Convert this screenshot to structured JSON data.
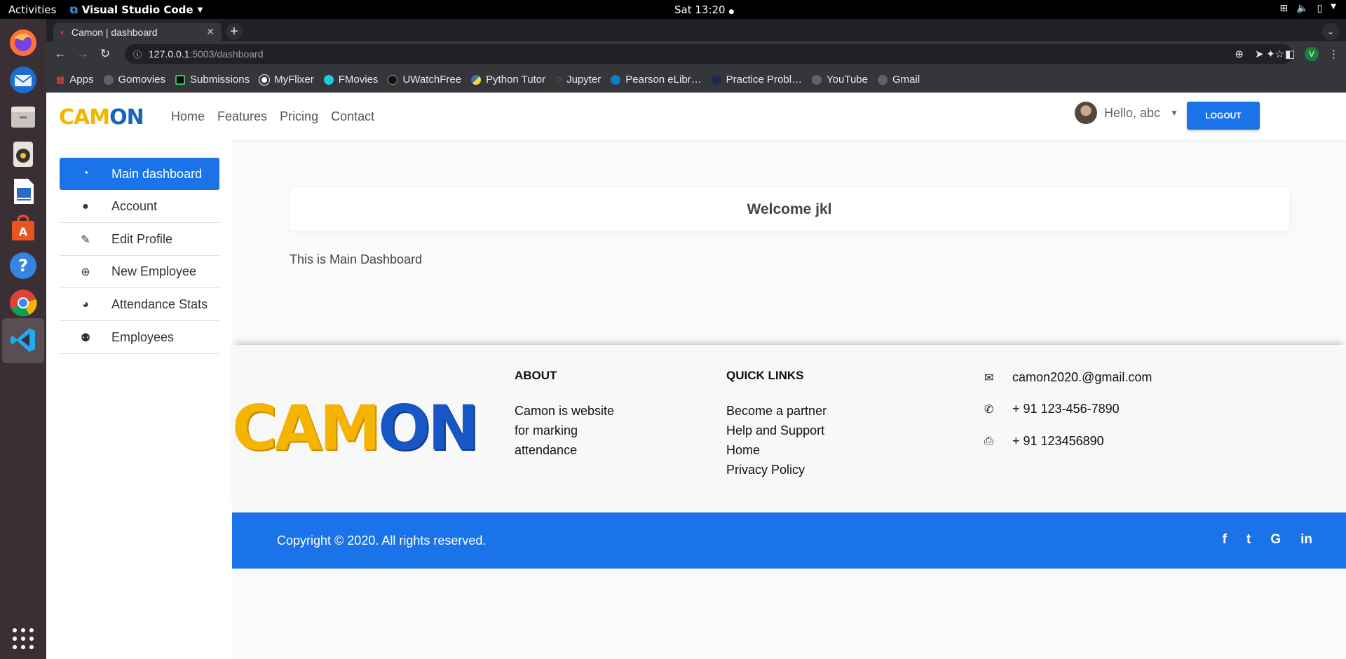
{
  "os": {
    "activities": "Activities",
    "app_name": "Visual Studio Code",
    "clock": "Sat 13:20"
  },
  "browser": {
    "tab_title": "Camon | dashboard",
    "url_host": "127.0.0.1",
    "url_rest": ":5003/dashboard",
    "profile_initial": "V",
    "bookmarks": [
      "Apps",
      "Gomovies",
      "Submissions",
      "MyFlixer",
      "FMovies",
      "UWatchFree",
      "Python Tutor",
      "Jupyter",
      "Pearson eLibr…",
      "Practice Probl…",
      "YouTube",
      "Gmail"
    ]
  },
  "navbar": {
    "logo_ca": "CAM",
    "logo_on": "ON",
    "links": [
      "Home",
      "Features",
      "Pricing",
      "Contact"
    ],
    "greeting": "Hello, abc",
    "logout_label": "LOGOUT"
  },
  "sidebar": {
    "items": [
      "Main dashboard",
      "Account",
      "Edit Profile",
      "New Employee",
      "Attendance Stats",
      "Employees"
    ]
  },
  "main": {
    "welcome": "Welcome jkl",
    "subtitle": "This is Main Dashboard"
  },
  "footer": {
    "logo_ca": "CAM",
    "logo_on": "ON",
    "about_heading": "ABOUT",
    "about_lines": [
      "Camon is website",
      "for marking",
      "attendance"
    ],
    "links_heading": "QUICK LINKS",
    "links": [
      "Become a partner",
      "Help and Support",
      "Home",
      "Privacy Policy"
    ],
    "email": "camon2020.@gmail.com",
    "phone": "+ 91 123-456-7890",
    "fax": "+ 91 123456890",
    "copyright": "Copyright © 2020. All rights reserved.",
    "socials": [
      "f",
      "t",
      "G",
      "in"
    ]
  },
  "colors": {
    "accent": "#1a73e8",
    "logo_yellow": "#f4b400",
    "logo_blue": "#1565c0"
  }
}
